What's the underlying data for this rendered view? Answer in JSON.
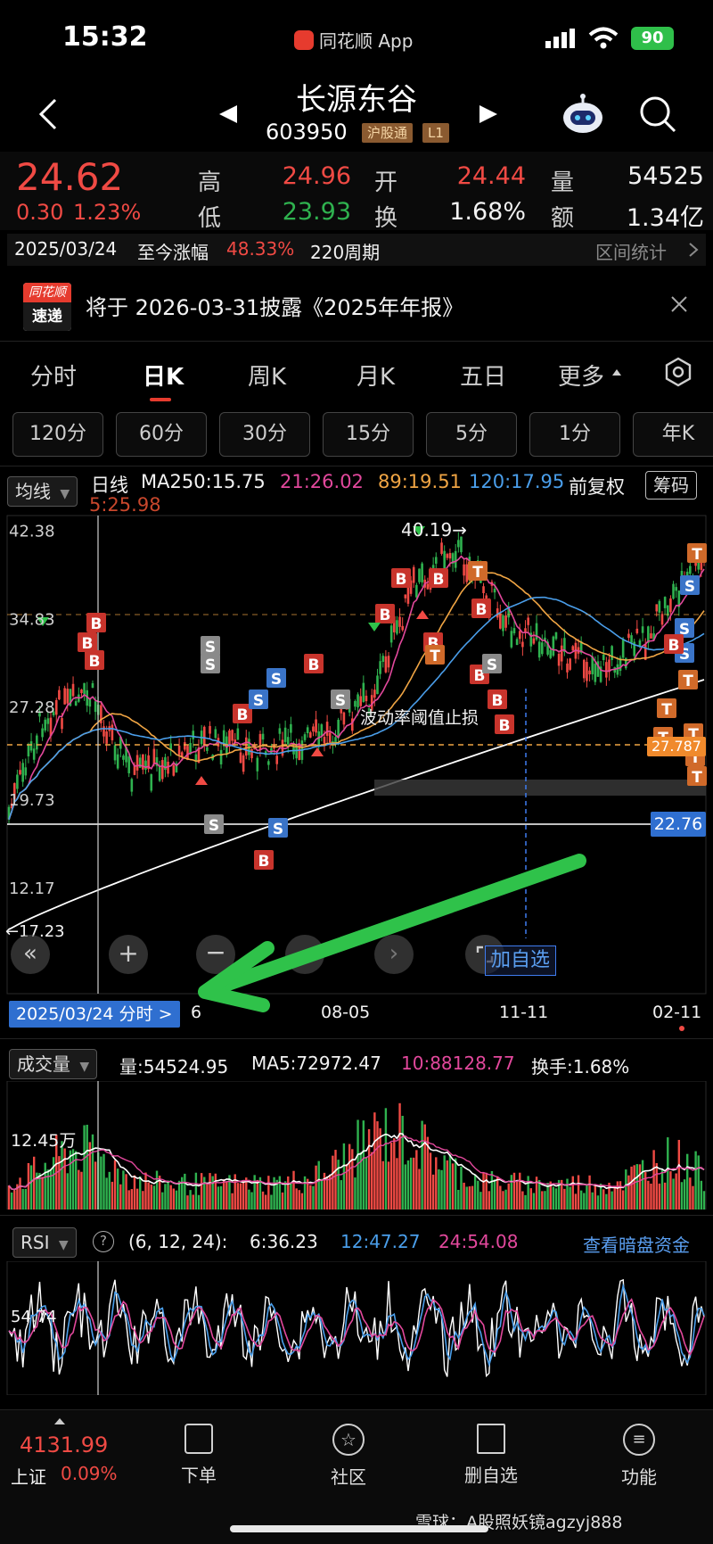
{
  "status": {
    "time": "15:32",
    "app": "同花顺 App",
    "battery": "90"
  },
  "header": {
    "title": "长源东谷",
    "code": "603950",
    "tag1": "沪股通",
    "tag2": "L1"
  },
  "quote": {
    "price": "24.62",
    "change": "0.30",
    "change_pct": "1.23%",
    "high_label": "高",
    "high": "24.96",
    "low_label": "低",
    "low": "23.93",
    "open_label": "开",
    "open": "24.44",
    "turnover_label": "换",
    "turnover": "1.68%",
    "volume_label": "量",
    "volume": "54525",
    "amount_label": "额",
    "amount": "1.34亿"
  },
  "period": {
    "start": "2025/03/24",
    "label": "至今涨幅",
    "gain": "48.33%",
    "weeks": "220周期",
    "link": "区间统计"
  },
  "notice": {
    "logo_top": "同花顺",
    "logo_bottom": "速递",
    "text": "将于 2026-03-31披露《2025年年报》"
  },
  "tabs": [
    "分时",
    "日K",
    "周K",
    "月K",
    "五日",
    "更多"
  ],
  "subtabs": [
    "120分",
    "60分",
    "30分",
    "15分",
    "5分",
    "1分",
    "年K"
  ],
  "ma_bar": {
    "select": "均线",
    "type": "日线",
    "ma250": "MA250:15.75",
    "ma21": "21:26.02",
    "ma89": "89:19.51",
    "ma120": "120:17.95",
    "ma5": "5:25.98",
    "adjust": "前复权",
    "chips": "筹码"
  },
  "kline": {
    "y_labels": [
      "42.38",
      "34.83",
      "27.28",
      "19.73",
      "12.17"
    ],
    "max_label": "40.19→",
    "min_label": "←17.23",
    "annotation": "波动率阈值止损",
    "price_tag_1": "27.787",
    "price_tag_2": "22.76",
    "add_watch": "加自选",
    "x_labels": [
      "08-05",
      "11-11",
      "02-11"
    ],
    "cursor_date": "2025/03/24 分时 >",
    "cursor_partial": "6",
    "marker_b": "B",
    "marker_s": "S",
    "marker_t": "T"
  },
  "volume_bar": {
    "select": "成交量",
    "vol": "量:54524.95",
    "ma5": "MA5:72972.47",
    "ma10": "10:88128.77",
    "turnover": "换手:1.68%",
    "axis": "12.45万"
  },
  "rsi_bar": {
    "select": "RSI",
    "help": "?",
    "params": "(6, 12, 24):",
    "rsi6": "6:36.23",
    "rsi12": "12:47.27",
    "rsi24": "24:54.08",
    "link": "查看暗盘资金",
    "axis": "54.74"
  },
  "bottom": {
    "index_value": "4131.99",
    "index_name": "上证",
    "index_pct": "0.09%",
    "nav": [
      "下单",
      "社区",
      "删自选",
      "功能"
    ],
    "watermark": "雪球：A股照妖镜agzyj888"
  },
  "colors": {
    "up": "#f04a44",
    "down": "#2fb24f",
    "accent": "#e63b2e",
    "arrow": "#2fc24a"
  }
}
